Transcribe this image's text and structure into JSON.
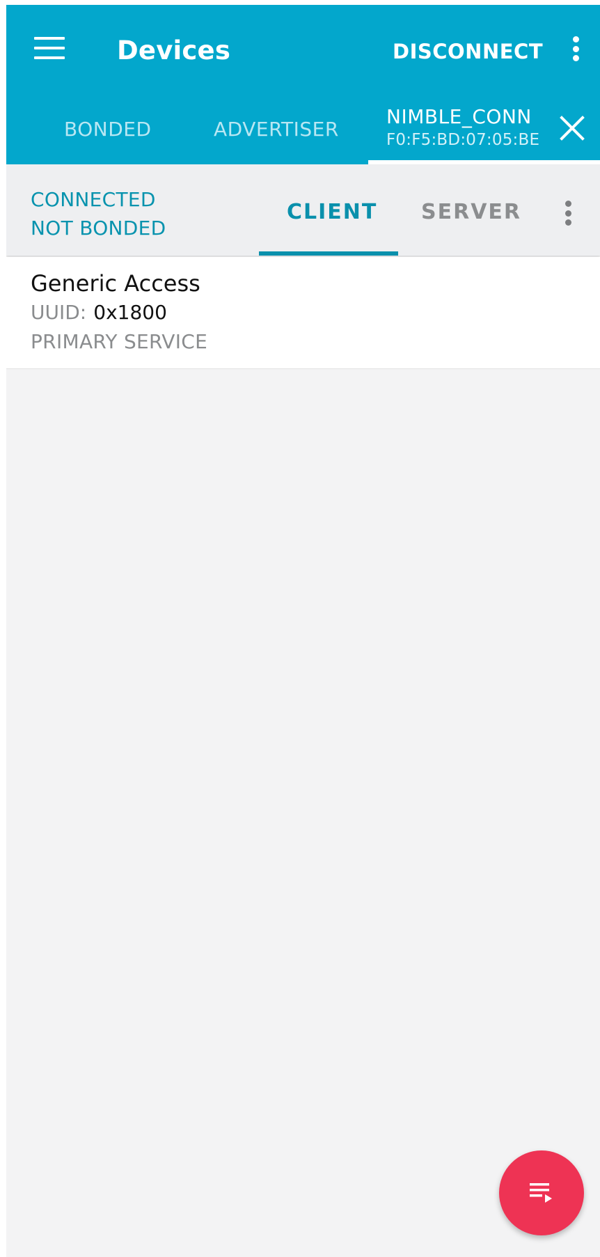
{
  "appbar": {
    "title": "Devices",
    "disconnect_label": "DISCONNECT",
    "menu_icon": "hamburger-menu-icon",
    "overflow_icon": "more-vert-icon",
    "background_color": "#03a7cc"
  },
  "device_tabs": {
    "bonded_label": "BONDED",
    "advertiser_label": "ADVERTISER",
    "active": {
      "name": "NIMBLE_CONN",
      "address": "F0:F5:BD:07:05:BE",
      "close_icon": "close-icon"
    }
  },
  "connection": {
    "status_line1": "CONNECTED",
    "status_line2": "NOT BONDED",
    "status_color": "#0893ae",
    "tabs": [
      {
        "label": "CLIENT",
        "selected": true
      },
      {
        "label": "SERVER",
        "selected": false
      }
    ],
    "overflow_icon": "more-vert-icon"
  },
  "services": [
    {
      "name": "Generic Access",
      "uuid_label": "UUID:",
      "uuid_value": "0x1800",
      "type": "PRIMARY SERVICE"
    }
  ],
  "fab": {
    "icon": "playlist-play-icon",
    "color": "#ee3354"
  }
}
